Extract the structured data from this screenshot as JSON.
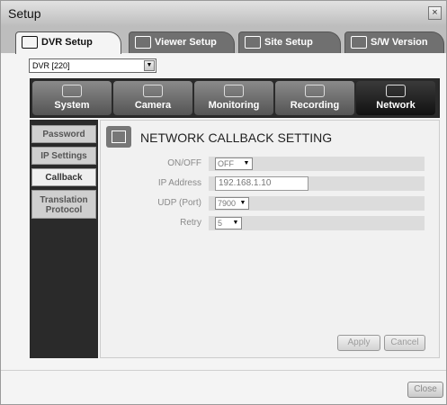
{
  "window": {
    "title": "Setup",
    "close_glyph": "×"
  },
  "tabs": [
    {
      "label": "DVR Setup",
      "icon": "dvr-icon",
      "active": true
    },
    {
      "label": "Viewer Setup",
      "icon": "viewer-icon",
      "active": false
    },
    {
      "label": "Site Setup",
      "icon": "globe-icon",
      "active": false
    },
    {
      "label": "S/W Version",
      "icon": "info-icon",
      "active": false
    }
  ],
  "dvr_select": {
    "value": "DVR [220]",
    "arrow": "▼"
  },
  "categories": [
    {
      "label": "System",
      "icon": "system-icon"
    },
    {
      "label": "Camera",
      "icon": "camera-icon"
    },
    {
      "label": "Monitoring",
      "icon": "monitor-icon"
    },
    {
      "label": "Recording",
      "icon": "recording-icon"
    },
    {
      "label": "Network",
      "icon": "network-icon",
      "active": true
    }
  ],
  "sidebar": {
    "items": [
      {
        "label": "Password"
      },
      {
        "label": "IP Settings"
      },
      {
        "label": "Callback",
        "active": true
      },
      {
        "label": "Translation Protocol"
      }
    ]
  },
  "section": {
    "title": "NETWORK CALLBACK SETTING",
    "icon": "network-icon"
  },
  "fields": {
    "onoff": {
      "label": "ON/OFF",
      "value": "OFF"
    },
    "ip": {
      "label": "IP Address",
      "value": "192.168.1.10"
    },
    "udp": {
      "label": "UDP (Port)",
      "value": "7900"
    },
    "retry": {
      "label": "Retry",
      "value": "5"
    },
    "arrow": "▼"
  },
  "buttons": {
    "apply": "Apply",
    "cancel": "Cancel",
    "close": "Close"
  }
}
